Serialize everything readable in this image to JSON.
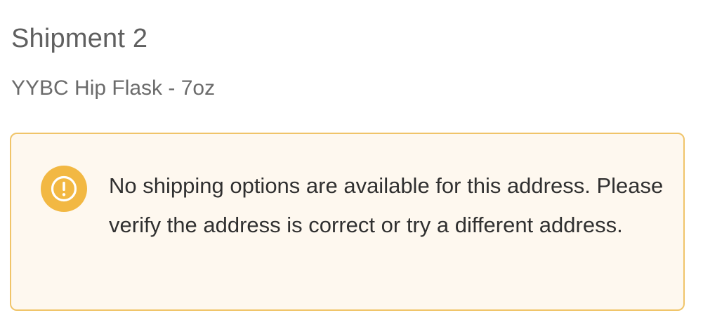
{
  "shipment": {
    "title": "Shipment 2",
    "product_name": "YYBC Hip Flask - 7oz"
  },
  "alert": {
    "icon": "warning-circle-icon",
    "message": "No shipping options are available for this address. Please verify the address is correct or try a different address.",
    "colors": {
      "background": "#fef8ef",
      "border": "#f0c469",
      "icon": "#f2b843"
    }
  }
}
